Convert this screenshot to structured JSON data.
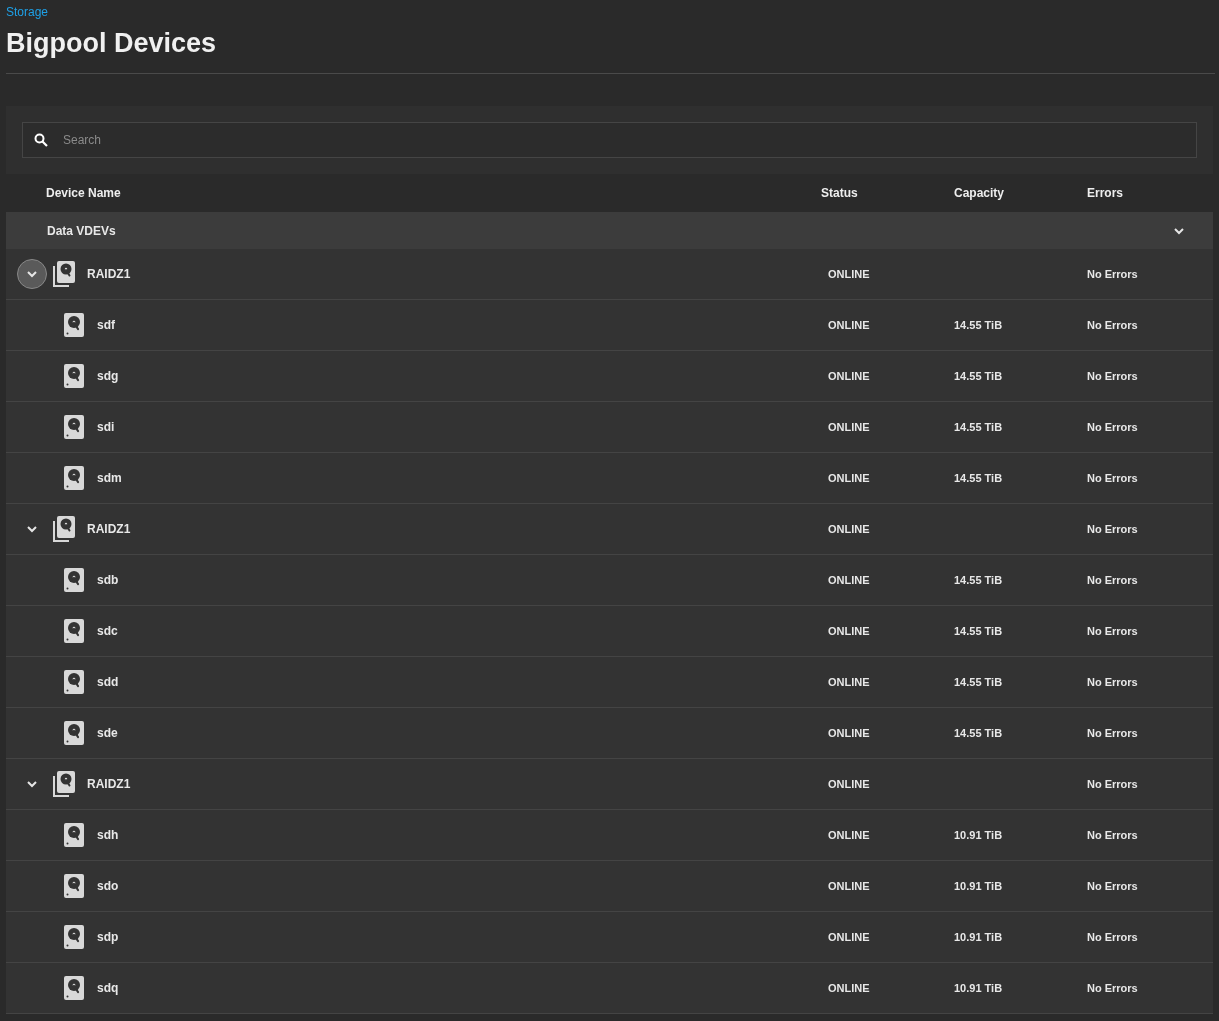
{
  "breadcrumb": "Storage",
  "title": "Bigpool Devices",
  "search": {
    "placeholder": "Search"
  },
  "columns": [
    "Device Name",
    "Status",
    "Capacity",
    "Errors"
  ],
  "group": {
    "label": "Data VDEVs",
    "expanded": true
  },
  "vdevs": [
    {
      "name": "RAIDZ1",
      "status": "ONLINE",
      "errors": "No Errors",
      "expanded": true,
      "selected": true,
      "disks": [
        {
          "name": "sdf",
          "status": "ONLINE",
          "capacity": "14.55 TiB",
          "errors": "No Errors"
        },
        {
          "name": "sdg",
          "status": "ONLINE",
          "capacity": "14.55 TiB",
          "errors": "No Errors"
        },
        {
          "name": "sdi",
          "status": "ONLINE",
          "capacity": "14.55 TiB",
          "errors": "No Errors"
        },
        {
          "name": "sdm",
          "status": "ONLINE",
          "capacity": "14.55 TiB",
          "errors": "No Errors"
        }
      ]
    },
    {
      "name": "RAIDZ1",
      "status": "ONLINE",
      "errors": "No Errors",
      "expanded": true,
      "selected": false,
      "disks": [
        {
          "name": "sdb",
          "status": "ONLINE",
          "capacity": "14.55 TiB",
          "errors": "No Errors"
        },
        {
          "name": "sdc",
          "status": "ONLINE",
          "capacity": "14.55 TiB",
          "errors": "No Errors"
        },
        {
          "name": "sdd",
          "status": "ONLINE",
          "capacity": "14.55 TiB",
          "errors": "No Errors"
        },
        {
          "name": "sde",
          "status": "ONLINE",
          "capacity": "14.55 TiB",
          "errors": "No Errors"
        }
      ]
    },
    {
      "name": "RAIDZ1",
      "status": "ONLINE",
      "errors": "No Errors",
      "expanded": true,
      "selected": false,
      "disks": [
        {
          "name": "sdh",
          "status": "ONLINE",
          "capacity": "10.91 TiB",
          "errors": "No Errors"
        },
        {
          "name": "sdo",
          "status": "ONLINE",
          "capacity": "10.91 TiB",
          "errors": "No Errors"
        },
        {
          "name": "sdp",
          "status": "ONLINE",
          "capacity": "10.91 TiB",
          "errors": "No Errors"
        },
        {
          "name": "sdq",
          "status": "ONLINE",
          "capacity": "10.91 TiB",
          "errors": "No Errors"
        }
      ]
    }
  ]
}
